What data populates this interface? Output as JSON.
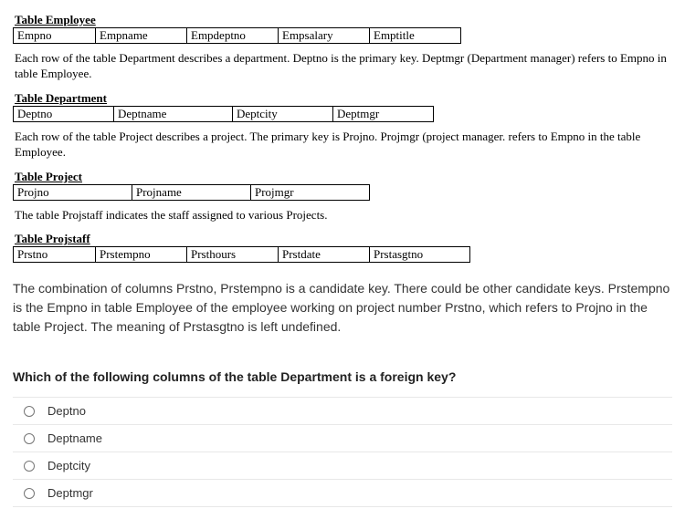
{
  "employee": {
    "caption": "Table Employee",
    "cols": [
      "Empno",
      "Empname",
      "Empdeptno",
      "Empsalary",
      "Emptitle"
    ]
  },
  "desc_dept": "Each row of the table Department describes a department. Deptno is the primary key. Deptmgr (Department manager) refers to Empno in table Employee.",
  "department": {
    "caption": "Table Department",
    "cols": [
      "Deptno",
      "Deptname",
      "Deptcity",
      "Deptmgr"
    ]
  },
  "desc_proj": "Each row of the table Project describes a project. The primary key is Projno. Projmgr (project manager. refers to Empno in the table Employee.",
  "project": {
    "caption": "Table Project",
    "cols": [
      "Projno",
      "Projname",
      "Projmgr"
    ]
  },
  "desc_projstaff": "The table Projstaff indicates the staff assigned to various Projects.",
  "projstaff": {
    "caption": "Table Projstaff",
    "cols": [
      "Prstno",
      "Prstempno",
      "Prsthours",
      "Prstdate",
      "Prstasgtno"
    ]
  },
  "explanation": "The combination of columns Prstno, Prstempno is a candidate key. There could be other candidate keys. Prstempno is the Empno in table Employee of the employee working on project number Prstno, which refers to Projno in the table Project. The meaning of Prstasgtno is left undefined.",
  "question": "Which of the following columns of the table Department is a foreign key?",
  "options": [
    "Deptno",
    "Deptname",
    "Deptcity",
    "Deptmgr"
  ]
}
